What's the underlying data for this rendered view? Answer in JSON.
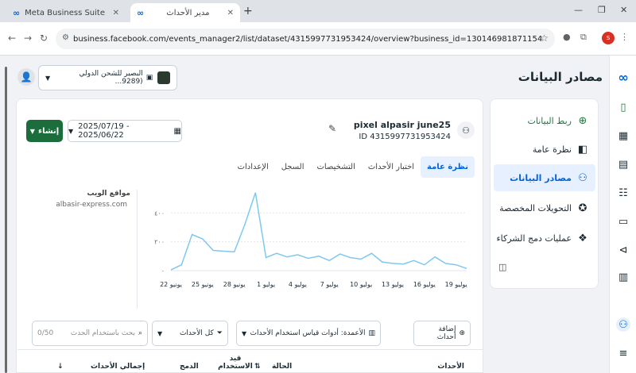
{
  "browser": {
    "tabs": [
      {
        "title": "Meta Business Suite",
        "close": "✕"
      },
      {
        "title": "مدير الأحداث",
        "close": "✕"
      }
    ],
    "new_tab": "+",
    "url": "business.facebook.com/events_manager2/list/dataset/4315997731953424/overview?business_id=130146981871154",
    "profile_initial": "s"
  },
  "header": {
    "page_title": "مصادر البيانات",
    "account_name": "البصير للشحن الدولي (9289..."
  },
  "sidebar": {
    "items": [
      {
        "label": "ربط البيانات",
        "icon": "⊕"
      },
      {
        "label": "نظرة عامة",
        "icon": "◧"
      },
      {
        "label": "مصادر البيانات",
        "icon": "⚇"
      },
      {
        "label": "التحويلات المخصصة",
        "icon": "✪"
      },
      {
        "label": "عمليات دمج الشركاء",
        "icon": "❖"
      }
    ]
  },
  "pixel": {
    "name": "pixel alpasir june25",
    "id": "ID 4315997731953424",
    "create_label": "إنشاء",
    "date_range": "2025/07/19 - 2025/06/22"
  },
  "tabs": [
    {
      "label": "نظرة عامة"
    },
    {
      "label": "اختبار الأحداث"
    },
    {
      "label": "التشخيصات"
    },
    {
      "label": "السجل"
    },
    {
      "label": "الإعدادات"
    }
  ],
  "site": {
    "title": "مواقع الويب",
    "url": "albasir-express.com"
  },
  "chart_data": {
    "type": "line",
    "y_ticks": [
      "٠",
      "٢٠٠",
      "٤٠٠"
    ],
    "ylim": [
      0,
      550
    ],
    "x_tick_labels": [
      "22 يونيو",
      "25 يونيو",
      "28 يونيو",
      "1 يوليو",
      "4 يوليو",
      "7 يوليو",
      "10 يوليو",
      "13 يوليو",
      "16 يوليو",
      "19 يوليو"
    ],
    "series": [
      {
        "color": "#7ec8f0",
        "values": [
          5,
          40,
          250,
          220,
          140,
          135,
          130,
          320,
          540,
          90,
          120,
          95,
          110,
          85,
          100,
          70,
          115,
          90,
          80,
          120,
          60,
          50,
          45,
          70,
          40,
          95,
          50,
          40,
          15
        ]
      }
    ]
  },
  "toolbar": {
    "add_events": "إضافة أحداث",
    "columns": "الأعمدة: أدوات قياس استخدام الأحداث",
    "all_events": "كل الأحداث",
    "search_placeholder": "بحث باستخدام الحدث",
    "search_count": "0/50"
  },
  "table": {
    "col_events": "الأحداث",
    "col_status": "الحالة",
    "col_in_use": "قيد الاستخدام",
    "col_merge": "الدمج",
    "col_total": "إجمالي الأحداث"
  }
}
